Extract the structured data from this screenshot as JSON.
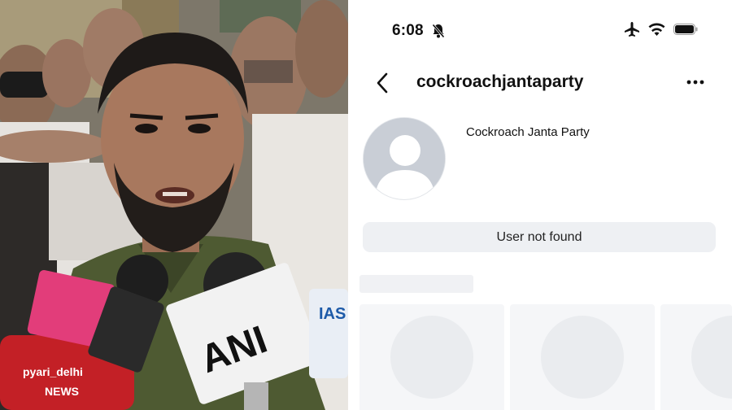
{
  "status_bar": {
    "time": "6:08",
    "icons": [
      "bell-off-icon",
      "airplane-icon",
      "wifi-icon",
      "battery-icon"
    ]
  },
  "profile": {
    "username": "cockroachjantaparty",
    "display_name": "Cockroach Janta Party",
    "message": "User not found"
  },
  "photo": {
    "mic_labels": {
      "ani": "ANI",
      "pyari_delhi": "pyari_delhi",
      "news": "NEWS",
      "ias": "IAS"
    }
  },
  "colors": {
    "panel_bg": "#ffffff",
    "message_bar": "#eef0f3",
    "skeleton": "#f5f6f8",
    "avatar_placeholder": "#c9ced6"
  }
}
